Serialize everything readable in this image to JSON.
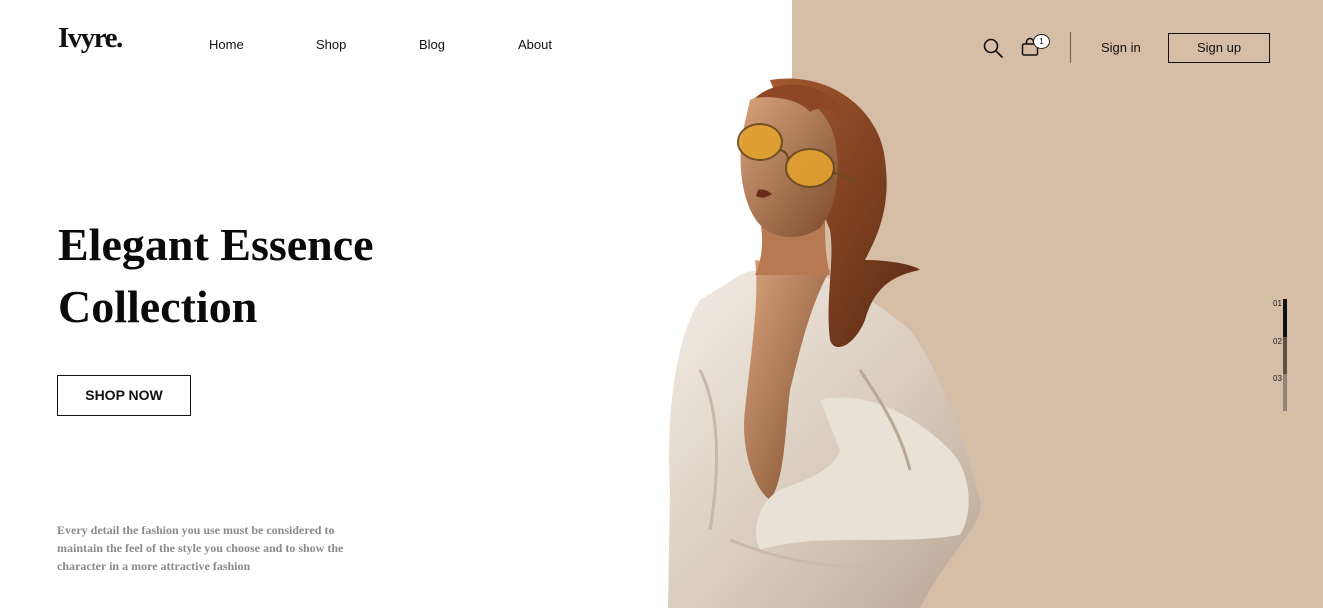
{
  "brand": {
    "logo_text": "Ivyre."
  },
  "nav": {
    "items": [
      "Home",
      "Shop",
      "Blog",
      "About"
    ]
  },
  "header": {
    "search_icon": "search-icon",
    "cart_icon": "shopping-bag-icon",
    "cart_count": "1",
    "signin_label": "Sign in",
    "signup_label": "Sign up"
  },
  "hero": {
    "title_line1": "Elegant Essence",
    "title_line2": "Collection",
    "cta_label": "SHOP NOW",
    "tagline": "Every detail the fashion you use must be considered to maintain the feel of the style you choose and to show the character in a more attractive fashion"
  },
  "pager": {
    "items": [
      "01",
      "02",
      "03"
    ],
    "active_index": 0
  },
  "colors": {
    "accent_panel": "#d6bda6",
    "text_primary": "#111111",
    "text_muted": "#8a8a8a"
  }
}
